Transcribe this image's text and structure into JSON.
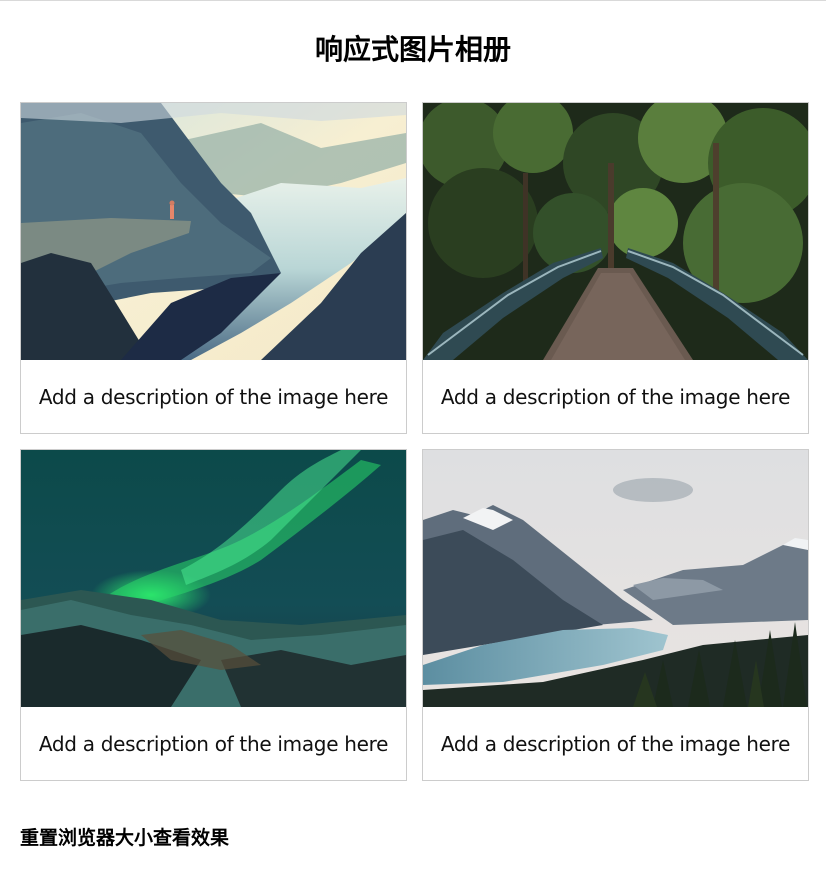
{
  "page": {
    "title": "响应式图片相册",
    "footer_note": "重置浏览器大小查看效果"
  },
  "gallery": {
    "items": [
      {
        "name": "fjord-cliff",
        "description": "Add a description of the image here"
      },
      {
        "name": "forest-bridge",
        "description": "Add a description of the image here"
      },
      {
        "name": "northern-lights",
        "description": "Add a description of the image here"
      },
      {
        "name": "mountain-lake",
        "description": "Add a description of the image here"
      }
    ]
  },
  "colors": {
    "card_border": "#cccccc",
    "text": "#000000",
    "background": "#ffffff"
  }
}
